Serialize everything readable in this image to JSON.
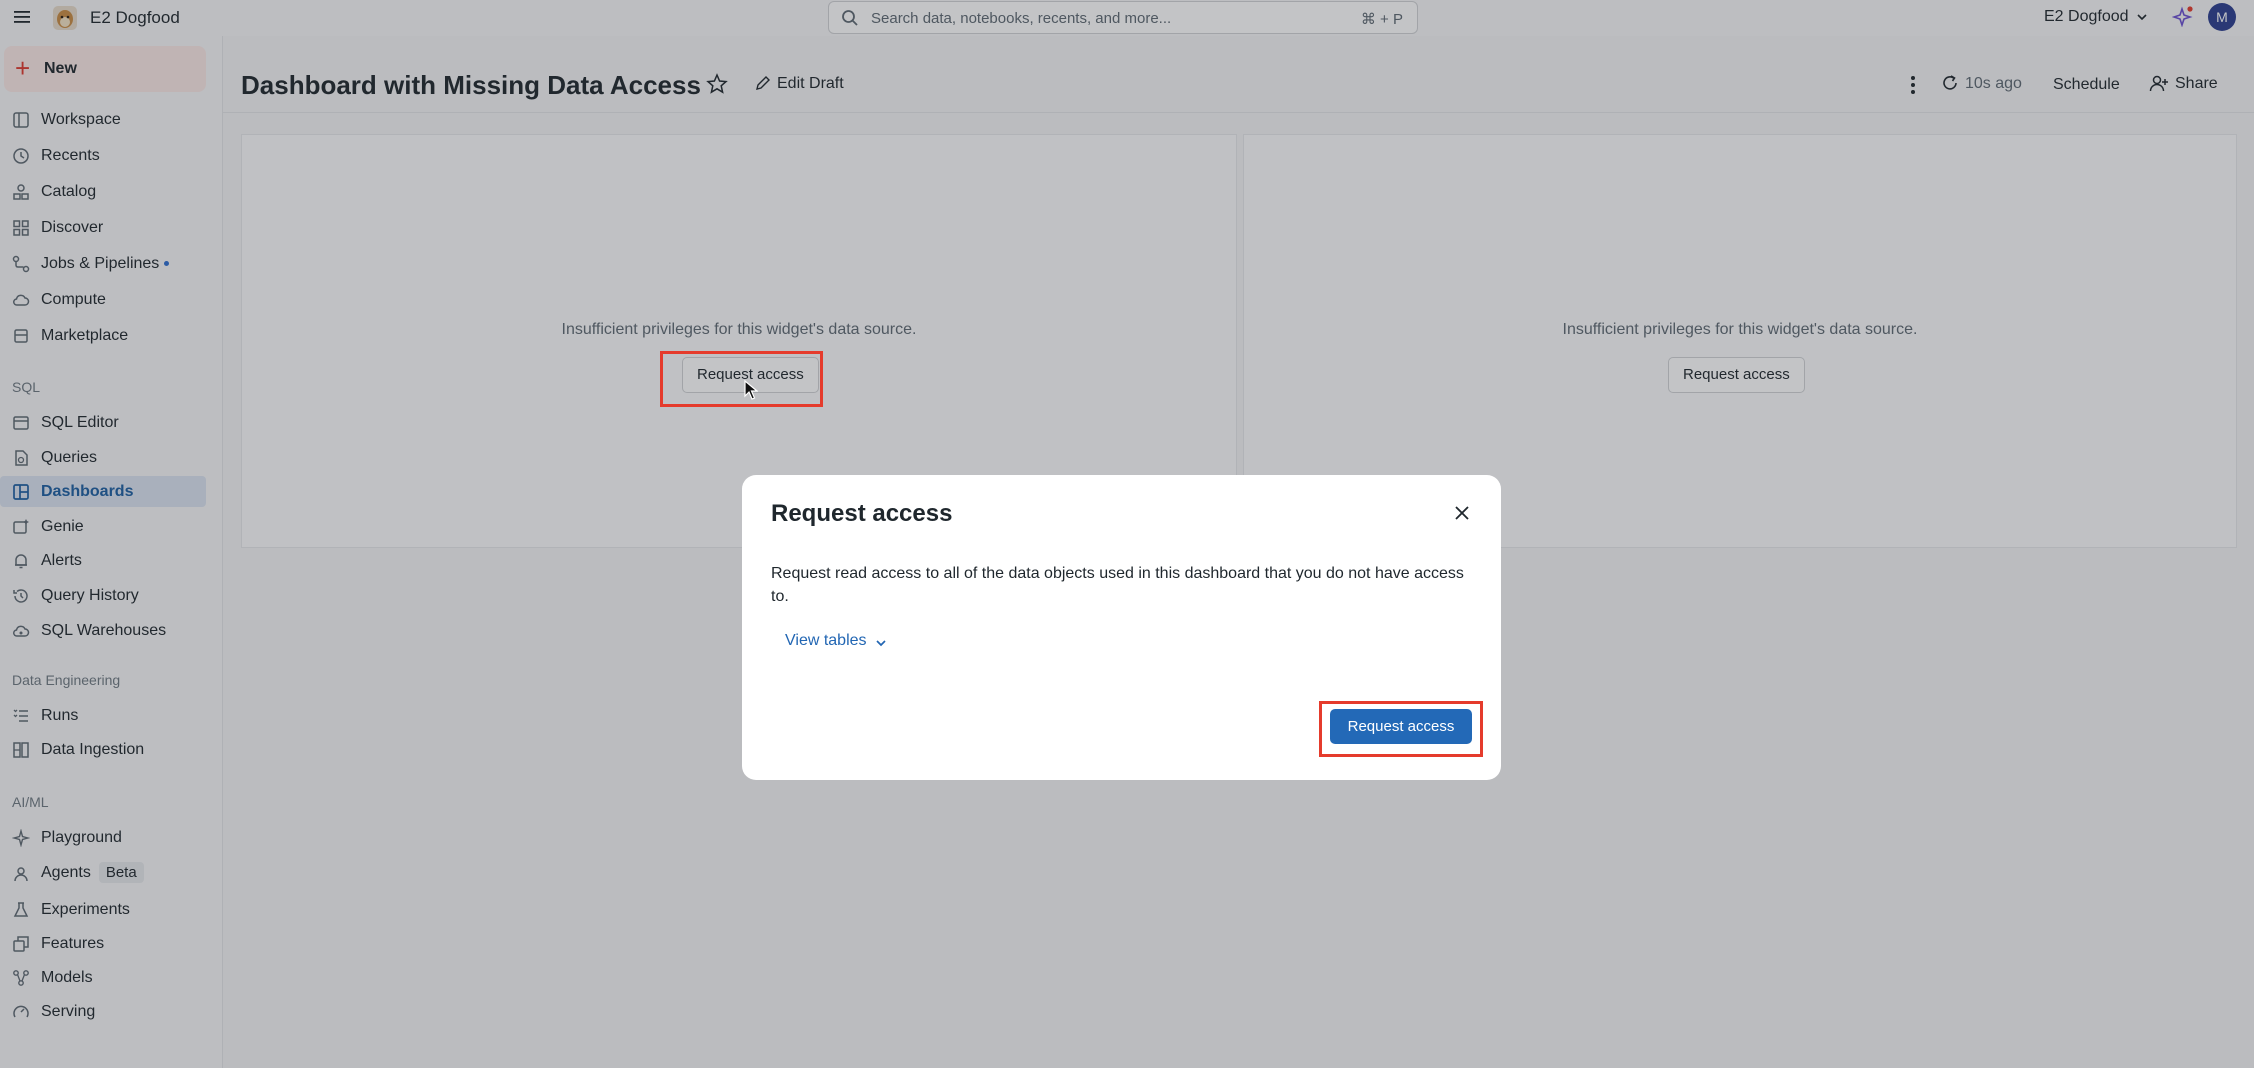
{
  "topbar": {
    "workspace_name": "E2 Dogfood",
    "search_placeholder": "Search data, notebooks, recents, and more...",
    "search_shortcut": "⌘ + P",
    "workspace_switcher": "E2 Dogfood",
    "avatar_initial": "M"
  },
  "sidebar": {
    "new_label": "New",
    "items_top": [
      {
        "label": "Workspace",
        "icon": "workspace-icon"
      },
      {
        "label": "Recents",
        "icon": "clock-icon"
      },
      {
        "label": "Catalog",
        "icon": "catalog-icon"
      },
      {
        "label": "Discover",
        "icon": "grid-icon"
      },
      {
        "label": "Jobs & Pipelines",
        "icon": "workflow-icon"
      },
      {
        "label": "Compute",
        "icon": "cloud-icon"
      },
      {
        "label": "Marketplace",
        "icon": "store-icon"
      }
    ],
    "sql_section": "SQL",
    "items_sql": [
      {
        "label": "SQL Editor",
        "icon": "editor-icon"
      },
      {
        "label": "Queries",
        "icon": "query-icon"
      },
      {
        "label": "Dashboards",
        "icon": "dashboard-icon"
      },
      {
        "label": "Genie",
        "icon": "genie-icon"
      },
      {
        "label": "Alerts",
        "icon": "bell-icon"
      },
      {
        "label": "Query History",
        "icon": "history-icon"
      },
      {
        "label": "SQL Warehouses",
        "icon": "warehouse-icon"
      }
    ],
    "de_section": "Data Engineering",
    "items_de": [
      {
        "label": "Runs",
        "icon": "runs-icon"
      },
      {
        "label": "Data Ingestion",
        "icon": "ingestion-icon"
      }
    ],
    "ai_section": "AI/ML",
    "items_ai": [
      {
        "label": "Playground",
        "icon": "sparkle-icon"
      },
      {
        "label": "Agents",
        "icon": "agents-icon"
      },
      {
        "label": "Experiments",
        "icon": "flask-icon"
      },
      {
        "label": "Features",
        "icon": "features-icon"
      },
      {
        "label": "Models",
        "icon": "models-icon"
      },
      {
        "label": "Serving",
        "icon": "serving-icon"
      }
    ],
    "beta_badge": "Beta"
  },
  "dashboard": {
    "title": "Dashboard with Missing Data Access",
    "edit_draft": "Edit Draft",
    "refresh_time": "10s ago",
    "schedule": "Schedule",
    "share": "Share",
    "widget_message": "Insufficient privileges for this widget's data source.",
    "widget_button": "Request access"
  },
  "modal": {
    "title": "Request access",
    "description": "Request read access to all of the data objects used in this dashboard that you do not have access to.",
    "view_tables": "View tables",
    "primary_button": "Request access"
  },
  "colors": {
    "accent": "#2369b7",
    "highlight": "#e53b2c",
    "active_nav_bg": "#dbe4f1"
  }
}
